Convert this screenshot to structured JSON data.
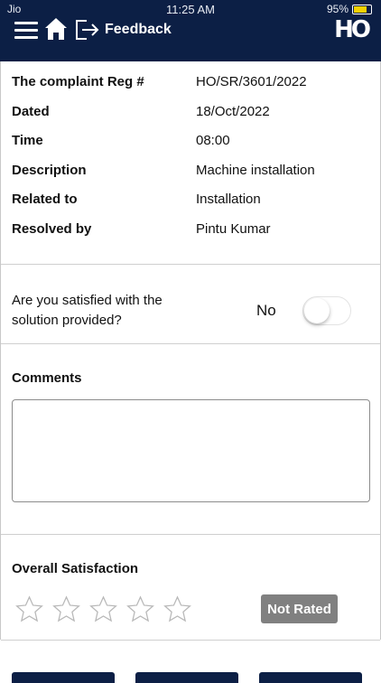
{
  "status_bar": {
    "carrier": "Jio",
    "time": "11:25 AM",
    "battery": "95%"
  },
  "header": {
    "title": "Feedback",
    "logo_text": "HO",
    "background": "#0c1f45"
  },
  "details": [
    {
      "label": "The complaint Reg #",
      "value": "HO/SR/3601/2022"
    },
    {
      "label": "Dated",
      "value": "18/Oct/2022"
    },
    {
      "label": "Time",
      "value": "08:00"
    },
    {
      "label": "Description",
      "value": "Machine installation"
    },
    {
      "label": "Related to",
      "value": "Installation"
    },
    {
      "label": "Resolved by",
      "value": "Pintu Kumar"
    }
  ],
  "satisfaction_question": {
    "text": "Are you satisfied with the solution provided?",
    "answer": "No",
    "toggle_on": false
  },
  "comments": {
    "title": "Comments",
    "value": ""
  },
  "rating": {
    "title": "Overall Satisfaction",
    "stars_total": 5,
    "stars_filled": 0,
    "status": "Not Rated"
  }
}
